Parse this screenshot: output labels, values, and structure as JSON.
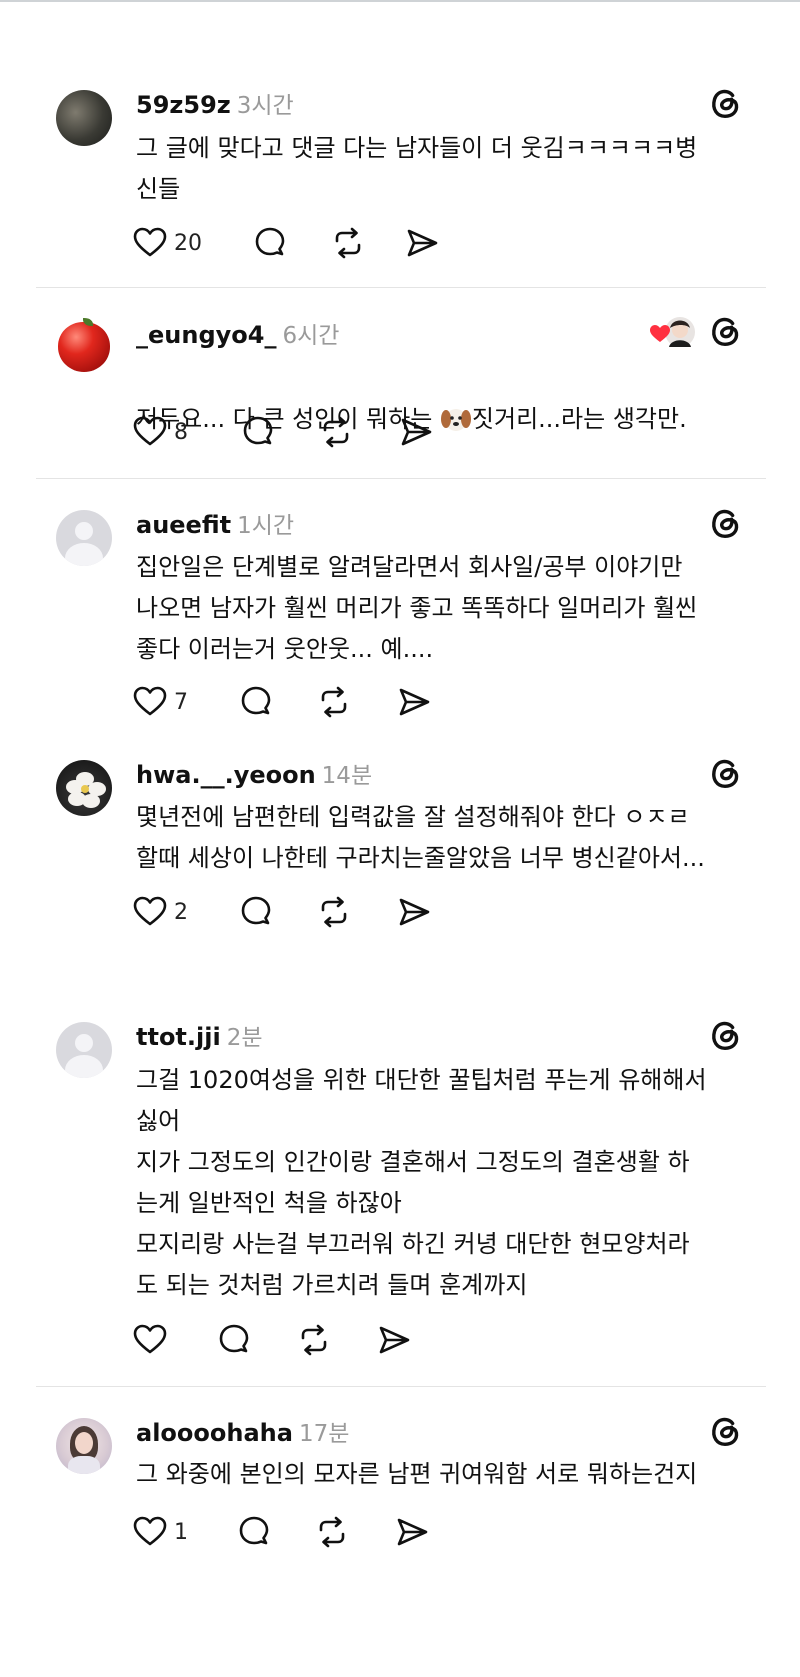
{
  "posts": [
    {
      "username": "59z59z",
      "time": "3시간",
      "text": "그 글에 맞다고 댓글 다는 남자들이 더 웃김ㅋㅋㅋㅋㅋ병\n신들",
      "likes": "20",
      "avatar": "photo-avatar"
    },
    {
      "username": "_eungyo4_",
      "time": "6시간",
      "text_before_emoji": "저두요... 다 큰 성인이 뭐하는 ",
      "emoji": "dog-face-emoji",
      "text_after_emoji": "짓거리...라는 생각만.",
      "likes": "8",
      "avatar": "apple-avatar",
      "liked_by_author": true
    },
    {
      "username": "aueefit",
      "time": "1시간",
      "text": "집안일은 단계별로 알려달라면서 회사일/공부 이야기만\n나오면 남자가 훨씬 머리가 좋고 똑똑하다 일머리가 훨씬\n좋다 이러는거 웃안웃... 예....",
      "likes": "7",
      "avatar": "default-avatar"
    },
    {
      "username": "hwa.__.yeoon",
      "time": "14분",
      "text": "몇년전에 남편한테 입력값을 잘 설정해줘야 한다 ㅇㅈㄹ\n할때 세상이 나한테 구라치는줄알았음 너무 병신같아서...",
      "likes": "2",
      "avatar": "flower-avatar"
    },
    {
      "username": "ttot.jji",
      "time": "2분",
      "text": "그걸 1020여성을 위한 대단한 꿀팁처럼 푸는게 유해해서\n싫어\n지가 그정도의 인간이랑 결혼해서 그정도의 결혼생활 하\n는게 일반적인 척을 하잖아\n모지리랑 사는걸 부끄러워 하긴 커녕 대단한 현모양처라\n도 되는 것처럼 가르치려 들며 훈계까지",
      "likes": "",
      "avatar": "default-avatar"
    },
    {
      "username": "aloooohaha",
      "time": "17분",
      "text": "그 와중에 본인의 모자른 남편 귀여워함 서로 뭐하는건지",
      "likes": "1",
      "avatar": "girl-avatar"
    }
  ],
  "icons": {
    "like": "heart-icon",
    "reply": "comment-icon",
    "repost": "repost-icon",
    "share": "send-icon",
    "app": "threads-logo-icon"
  },
  "colors": {
    "text": "#111111",
    "muted": "#9a9a9a",
    "divider": "#e4e4e4",
    "heart_red": "#ff3040"
  }
}
